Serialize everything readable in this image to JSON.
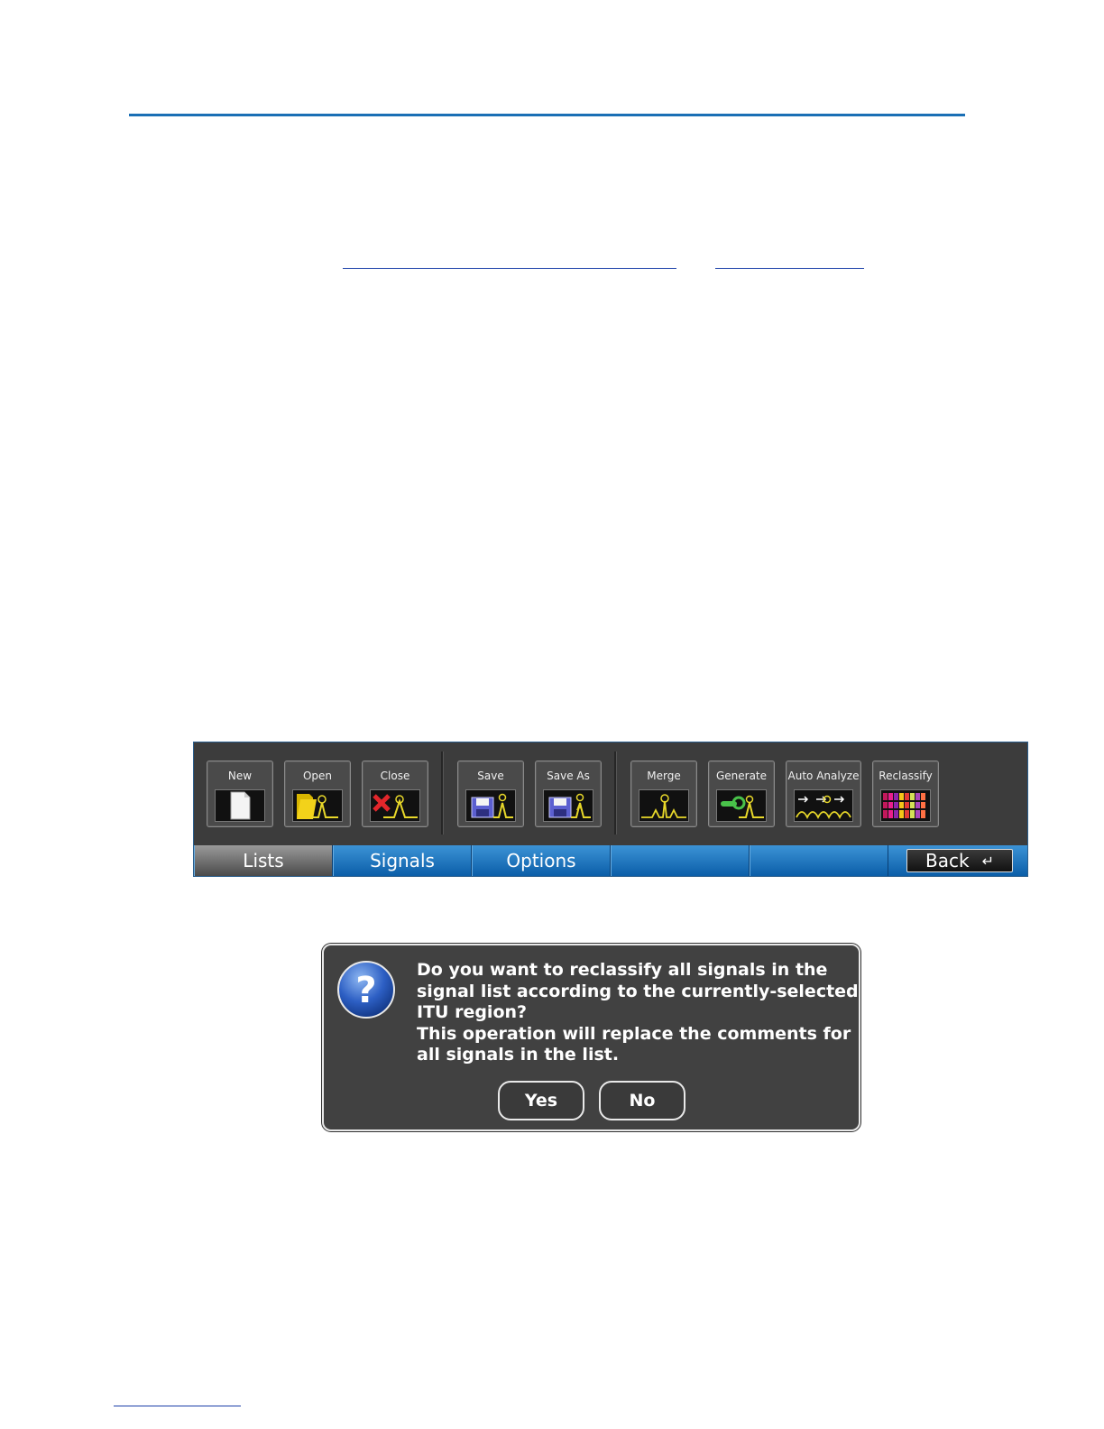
{
  "toolbar": {
    "buttons": [
      {
        "label": "New",
        "icon": "new-document-icon"
      },
      {
        "label": "Open",
        "icon": "open-folder-icon"
      },
      {
        "label": "Close",
        "icon": "close-list-icon"
      },
      {
        "label": "Save",
        "icon": "save-disk-icon"
      },
      {
        "label": "Save As",
        "icon": "save-as-disk-icon"
      },
      {
        "label": "Merge",
        "icon": "merge-icon"
      },
      {
        "label": "Generate",
        "icon": "generate-icon"
      },
      {
        "label": "Auto Analyze",
        "icon": "auto-analyze-icon"
      },
      {
        "label": "Reclassify",
        "icon": "reclassify-icon"
      }
    ],
    "tabs": [
      {
        "label": "Lists",
        "active": true
      },
      {
        "label": "Signals",
        "active": false
      },
      {
        "label": "Options",
        "active": false
      },
      {
        "label": "",
        "active": false
      },
      {
        "label": "",
        "active": false
      }
    ],
    "back_label": "Back",
    "back_glyph": "↵"
  },
  "dialog": {
    "icon": "question-icon",
    "icon_glyph": "?",
    "message_lines": [
      "Do you want to reclassify all signals in the",
      "signal list according to the currently-selected",
      "ITU region?",
      "This operation will replace the comments for",
      "all signals in the list."
    ],
    "yes_label": "Yes",
    "no_label": "No"
  },
  "colors": {
    "accent_blue": "#1a6fb5",
    "trace_yellow": "#e8d82a",
    "toolbar_bg": "#3c3c3c",
    "dialog_bg": "#414141"
  }
}
